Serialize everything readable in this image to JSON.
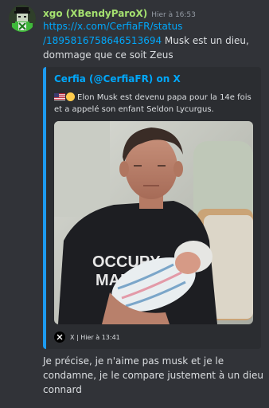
{
  "message": {
    "username": "xgo (XBendyParoX)",
    "timestamp": "Hier à 16:53",
    "link_line1": "https://x.com/CerfiaFR/status",
    "link_line2": "/1895816758646513694",
    "text_line1_rest": " Musk est un dieu,",
    "text_line2": "dommage que ce soit Zeus"
  },
  "embed": {
    "author": "Cerfia (@CerfiaFR) on X",
    "desc_line1": "Elon Musk est devenu papa pour la 14e fois",
    "desc_line2": "et a appelé son enfant Seldon Lycurgus.",
    "shirt_line1": "OCCUPY",
    "shirt_line2": "MARS",
    "footer": "X | Hier à 13:41",
    "accent": "#1d9bf0"
  },
  "reply": {
    "line1": "Je précise, je n'aime pas musk et je le",
    "line2": "condamne, je le compare justement à un dieu",
    "line3": "connard"
  },
  "colors": {
    "background": "#313338",
    "embed_bg": "#2b2d31",
    "username": "#a4e06f",
    "link": "#00a8fc"
  }
}
